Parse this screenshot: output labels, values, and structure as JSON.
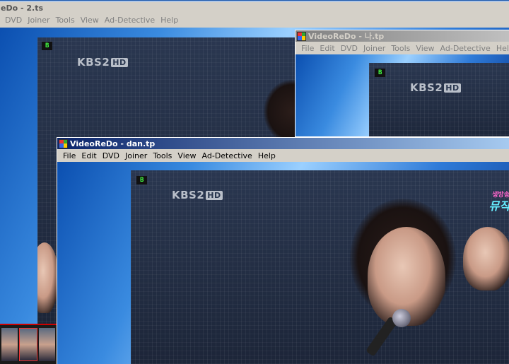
{
  "windows": {
    "back": {
      "title": "eDo - 2.ts",
      "menu": [
        "DVD",
        "Joiner",
        "Tools",
        "View",
        "Ad-Detective",
        "Help"
      ],
      "badge": "B",
      "logo": "KBS2",
      "logo_hd": "HD"
    },
    "middle": {
      "title": "VideoReDo - 나.tp",
      "menu": [
        "File",
        "Edit",
        "DVD",
        "Joiner",
        "Tools",
        "View",
        "Ad-Detective",
        "Help"
      ],
      "badge": "B",
      "logo": "KBS2",
      "logo_hd": "HD"
    },
    "front": {
      "title": "VideoReDo - dan.tp",
      "menu": [
        "File",
        "Edit",
        "DVD",
        "Joiner",
        "Tools",
        "View",
        "Ad-Detective",
        "Help"
      ],
      "badge": "B",
      "logo": "KBS2",
      "logo_hd": "HD",
      "promo_small": "생방송",
      "promo_big": "뮤직"
    }
  },
  "colors": {
    "active_title": "#0a246a",
    "inactive_title": "#808080",
    "badge_text": "#44ff44"
  }
}
